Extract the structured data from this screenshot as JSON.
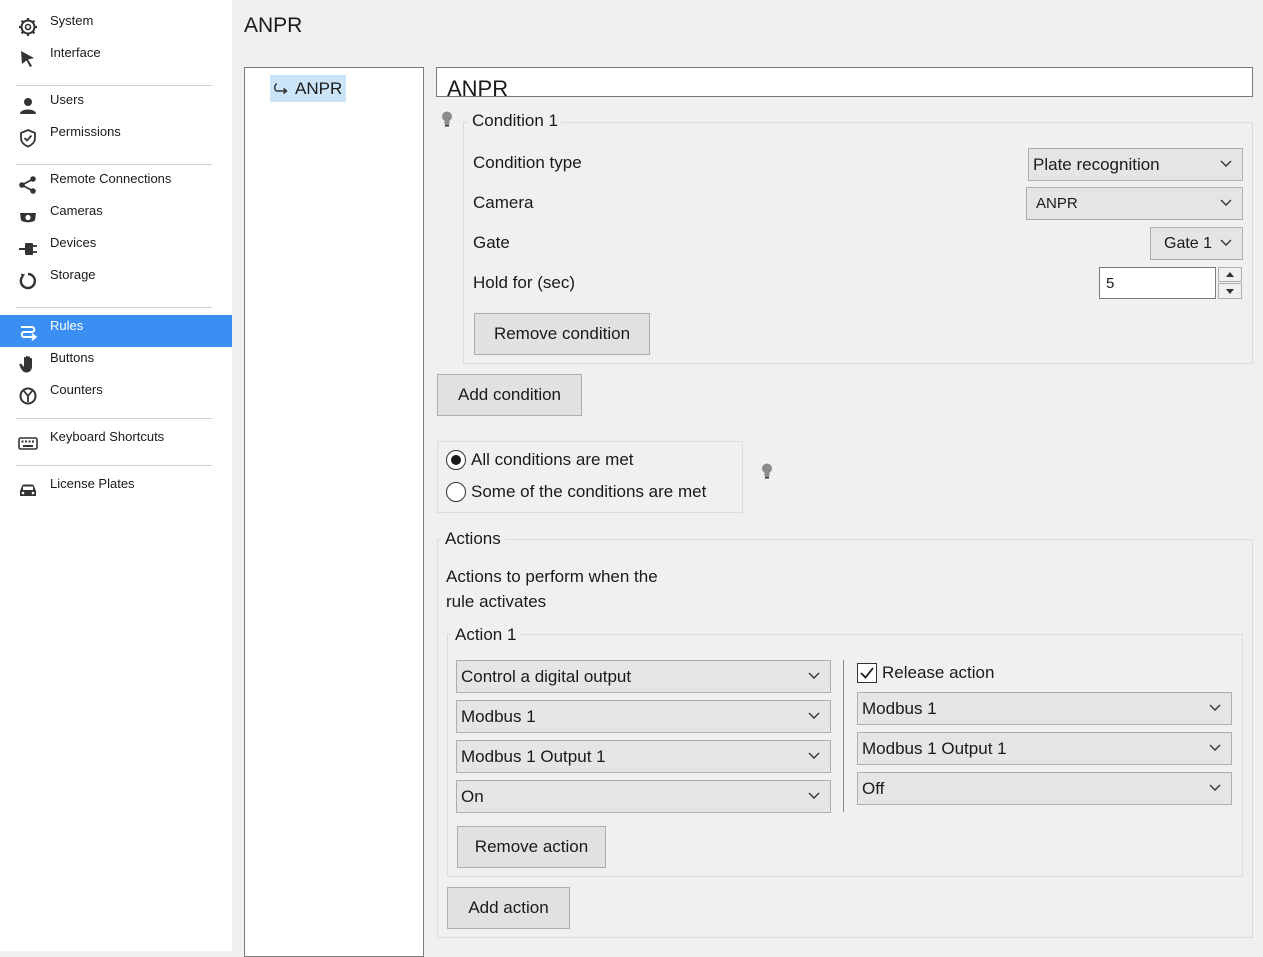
{
  "sidebar": {
    "items": [
      {
        "label": "System",
        "icon": "gear-icon"
      },
      {
        "label": "Interface",
        "icon": "cursor-icon"
      },
      {
        "label": "Users",
        "icon": "user-icon"
      },
      {
        "label": "Permissions",
        "icon": "shield-icon"
      },
      {
        "label": "Remote Connections",
        "icon": "share-icon"
      },
      {
        "label": "Cameras",
        "icon": "camera-icon"
      },
      {
        "label": "Devices",
        "icon": "plug-icon"
      },
      {
        "label": "Storage",
        "icon": "storage-icon"
      },
      {
        "label": "Rules",
        "icon": "rules-icon"
      },
      {
        "label": "Buttons",
        "icon": "hand-icon"
      },
      {
        "label": "Counters",
        "icon": "counter-icon"
      },
      {
        "label": "Keyboard Shortcuts",
        "icon": "keyboard-icon"
      },
      {
        "label": "License Plates",
        "icon": "car-icon"
      }
    ],
    "active": "Rules",
    "accent_color": "#3b8ff3"
  },
  "page": {
    "title": "ANPR"
  },
  "tree": {
    "items": [
      {
        "label": "ANPR",
        "icon": "rule-arrow-icon"
      }
    ]
  },
  "rule": {
    "name": "ANPR"
  },
  "condition": {
    "title": "Condition 1",
    "type_label": "Condition type",
    "type_value": "Plate recognition",
    "camera_label": "Camera",
    "camera_value": "ANPR",
    "gate_label": "Gate",
    "gate_value": "Gate 1",
    "hold_label": "Hold for (sec)",
    "hold_value": "5",
    "remove_label": "Remove condition"
  },
  "add_condition_label": "Add condition",
  "match_mode": {
    "options": [
      "All conditions are met",
      "Some of the conditions are met"
    ],
    "selected": "All conditions are met"
  },
  "actions": {
    "title": "Actions",
    "description_line1": "Actions to perform when the",
    "description_line2": "rule activates",
    "action1": {
      "title": "Action 1",
      "type_value": "Control a digital output",
      "device_value": "Modbus 1",
      "output_value": "Modbus 1 Output 1",
      "state_value": "On",
      "release_checked": true,
      "release_label": "Release action",
      "release_device_value": "Modbus 1",
      "release_output_value": "Modbus 1 Output 1",
      "release_state_value": "Off",
      "remove_label": "Remove action"
    },
    "add_label": "Add action"
  }
}
